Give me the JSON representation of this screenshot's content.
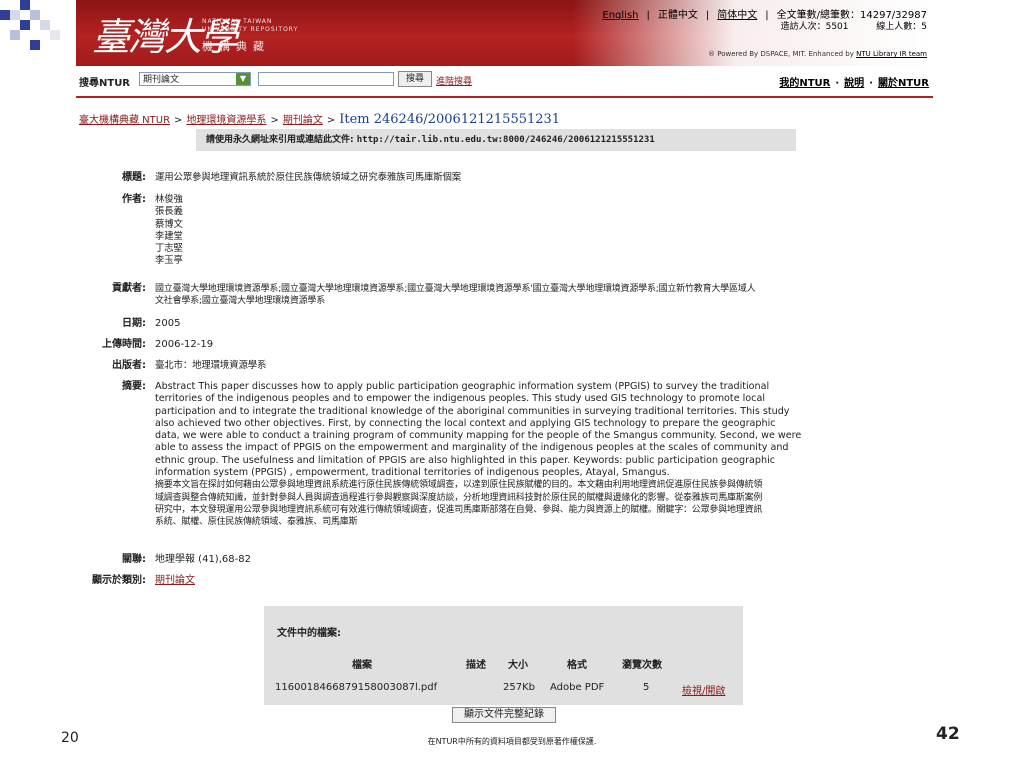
{
  "header": {
    "logo_calligraphy": "臺灣大學",
    "logo_en_line1": "NATIONAL TAIWAN",
    "logo_en_line2": "UNIVERSITY REPOSITORY",
    "logo_zh": "機構典藏",
    "nav": {
      "english": "English",
      "traditional": "正體中文",
      "simplified": "简体中文"
    },
    "stats": {
      "line1_label": "全文筆數/總筆數：",
      "line1_value": "14297/32987",
      "visits_label": "造訪人次：",
      "visits_value": "5501",
      "online_label": "線上人數：",
      "online_value": "5"
    },
    "powered_text": "® Powered By DSPACE, MIT. Enhanced by",
    "powered_link": "NTU Library IR team"
  },
  "search": {
    "label": "搜尋NTUR",
    "scope_selected": "期刊論文",
    "query_value": "",
    "button": "搜尋",
    "advanced": "進階搜尋",
    "my_ntur": "我的NTUR",
    "help": "說明",
    "about": "關於NTUR"
  },
  "breadcrumb": {
    "root": "臺大機構典藏 NTUR",
    "dept": "地理環境資源學系",
    "collection": "期刊論文",
    "item": "Item 246246/2006121215551231"
  },
  "cite": {
    "label": "請使用永久網址來引用或連結此文件:",
    "url": "http://tair.lib.ntu.edu.tw:8000/246246/2006121215551231"
  },
  "record": {
    "title_label": "標題:",
    "title": "運用公眾參與地理資訊系統於原住民族傳統領域之研究泰雅族司馬庫斯個案",
    "authors_label": "作者:",
    "authors": [
      "林俊強",
      "張長義",
      "蔡博文",
      "李建堂",
      "丁志堅",
      "李玉亭"
    ],
    "contrib_label": "貢獻者:",
    "contrib_line1": "國立臺灣大學地理環境資源學系;國立臺灣大學地理環境資源學系;國立臺灣大學地理環境資源學系'國立臺灣大學地理環境資源學系;國立新竹教育大學區域人",
    "contrib_line2": "文社會學系;國立臺灣大學地理環境資源學系",
    "date_label": "日期:",
    "date": "2005",
    "upload_label": "上傳時間:",
    "upload": "2006-12-19",
    "publisher_label": "出版者:",
    "publisher": "臺北市：地理環境資源學系",
    "abstract_label": "摘要:",
    "abstract_en": [
      "Abstract This paper discusses how to apply public participation geographic information system (PPGIS) to survey the traditional",
      "territories of the indigenous peoples and to empower the indigenous peoples. This study used GIS technology to promote local",
      "participation and to integrate the traditional knowledge of the aboriginal communities in surveying traditional territories. This study",
      "also achieved two other objectives. First, by connecting the local context and applying GIS technology to prepare the geographic",
      "data, we were able to conduct a training program of community mapping for the people of the Smangus community. Second, we were",
      "able to assess the impact of PPGIS on the empowerment and marginality of the indigenous peoples at the scales of community and",
      "ethnic group. The usefulness and limitation of PPGIS are also highlighted in this paper. Keywords: public participation geographic",
      "information system (PPGIS) , empowerment, traditional territories of indigenous peoples, Atayal, Smangus."
    ],
    "abstract_zh": [
      "摘要本文旨在探討如何藉由公眾參與地理資訊系統進行原住民族傳統領域調查，以達到原住民族賦權的目的。本文藉由利用地理資訊促進原住民族參與傳統領",
      "域調查與整合傳統知識，並針對參與人員與調查過程進行參與觀察與深度訪談，分析地理資訊科技對於原住民的賦權與邊緣化的影響。從泰雅族司馬庫斯案例",
      "研究中，本文發現運用公眾參與地理資訊系統可有效進行傳統領域調查，促進司馬庫斯部落在自覺、參與、能力與資源上的賦權。關鍵字：公眾參與地理資訊",
      "系統、賦權、原住民族傳統領域、泰雅族、司馬庫斯"
    ],
    "relation_label": "關聯:",
    "relation": "地理學報 (41),68-82",
    "category_label": "顯示於類別:",
    "category": "期刊論文"
  },
  "files": {
    "title": "文件中的檔案:",
    "headers": {
      "file": "檔案",
      "desc": "描述",
      "size": "大小",
      "format": "格式",
      "views": "瀏覽次數"
    },
    "rows": [
      {
        "file": "1160018466879158003087l.pdf",
        "desc": "",
        "size": "257Kb",
        "format": "Adobe PDF",
        "views": "5",
        "action": "檢視/開啟"
      }
    ],
    "full_record_button": "顯示文件完整紀錄"
  },
  "footer": {
    "copyright": "在NTUR中所有的資料項目都受到原著作權保護.",
    "year_fragment": "20",
    "page_number": "42"
  },
  "colors": {
    "banner": "#a11b1b",
    "link": "#8b1a1a",
    "item_blue": "#1a3f8f",
    "box_gray": "#e0e0e0"
  }
}
